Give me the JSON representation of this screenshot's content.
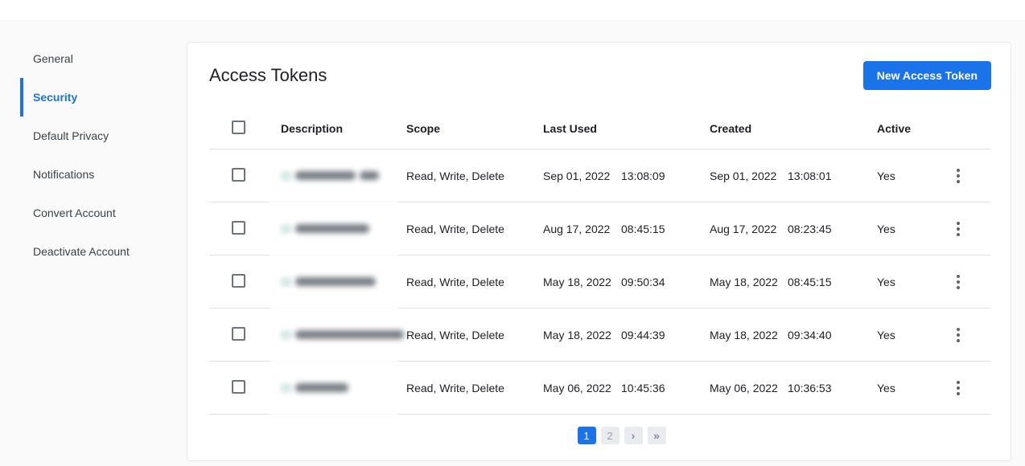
{
  "colors": {
    "accent": "#1a73e8",
    "page_bg": "#fafafa",
    "card_bg": "#ffffff",
    "text": "#202124",
    "sidebar_text": "#3c4043",
    "divider": "#e0e0e0",
    "pagination_inactive_bg": "#e9ebee",
    "kebab_dot": "#5f6368"
  },
  "sidebar": {
    "items": [
      {
        "label": "General",
        "active": false
      },
      {
        "label": "Security",
        "active": true
      },
      {
        "label": "Default Privacy",
        "active": false
      },
      {
        "label": "Notifications",
        "active": false
      },
      {
        "label": "Convert Account",
        "active": false
      },
      {
        "label": "Deactivate Account",
        "active": false
      }
    ]
  },
  "panel": {
    "title": "Access Tokens",
    "new_token_button": "New Access Token",
    "table": {
      "columns": [
        "Description",
        "Scope",
        "Last Used",
        "Created",
        "Active"
      ],
      "select_all_checked": false,
      "rows": [
        {
          "description": "(redacted)",
          "redacted_segments": [
            75,
            24
          ],
          "checked": false,
          "scope": "Read, Write, Delete",
          "last_used_date": "Sep 01, 2022",
          "last_used_time": "13:08:09",
          "created_date": "Sep 01, 2022",
          "created_time": "13:08:01",
          "active": "Yes",
          "row_menu_icon": "kebab-vertical"
        },
        {
          "description": "(redacted)",
          "redacted_segments": [
            92
          ],
          "checked": false,
          "scope": "Read, Write, Delete",
          "last_used_date": "Aug 17, 2022",
          "last_used_time": "08:45:15",
          "created_date": "Aug 17, 2022",
          "created_time": "08:23:45",
          "active": "Yes",
          "row_menu_icon": "kebab-vertical"
        },
        {
          "description": "(redacted)",
          "redacted_segments": [
            100
          ],
          "checked": false,
          "scope": "Read, Write, Delete",
          "last_used_date": "May 18, 2022",
          "last_used_time": "09:50:34",
          "created_date": "May 18, 2022",
          "created_time": "08:45:15",
          "active": "Yes",
          "row_menu_icon": "kebab-vertical"
        },
        {
          "description": "(redacted)",
          "redacted_segments": [
            135
          ],
          "checked": false,
          "scope": "Read, Write, Delete",
          "last_used_date": "May 18, 2022",
          "last_used_time": "09:44:39",
          "created_date": "May 18, 2022",
          "created_time": "09:34:40",
          "active": "Yes",
          "row_menu_icon": "kebab-vertical"
        },
        {
          "description": "(redacted)",
          "redacted_segments": [
            66
          ],
          "checked": false,
          "scope": "Read, Write, Delete",
          "last_used_date": "May 06, 2022",
          "last_used_time": "10:45:36",
          "created_date": "May 06, 2022",
          "created_time": "10:36:53",
          "active": "Yes",
          "row_menu_icon": "kebab-vertical"
        }
      ]
    },
    "pagination": {
      "pages": [
        "1",
        "2"
      ],
      "current": "1",
      "next_icon": "chevron-right",
      "last_icon": "double-chevron-right"
    }
  }
}
